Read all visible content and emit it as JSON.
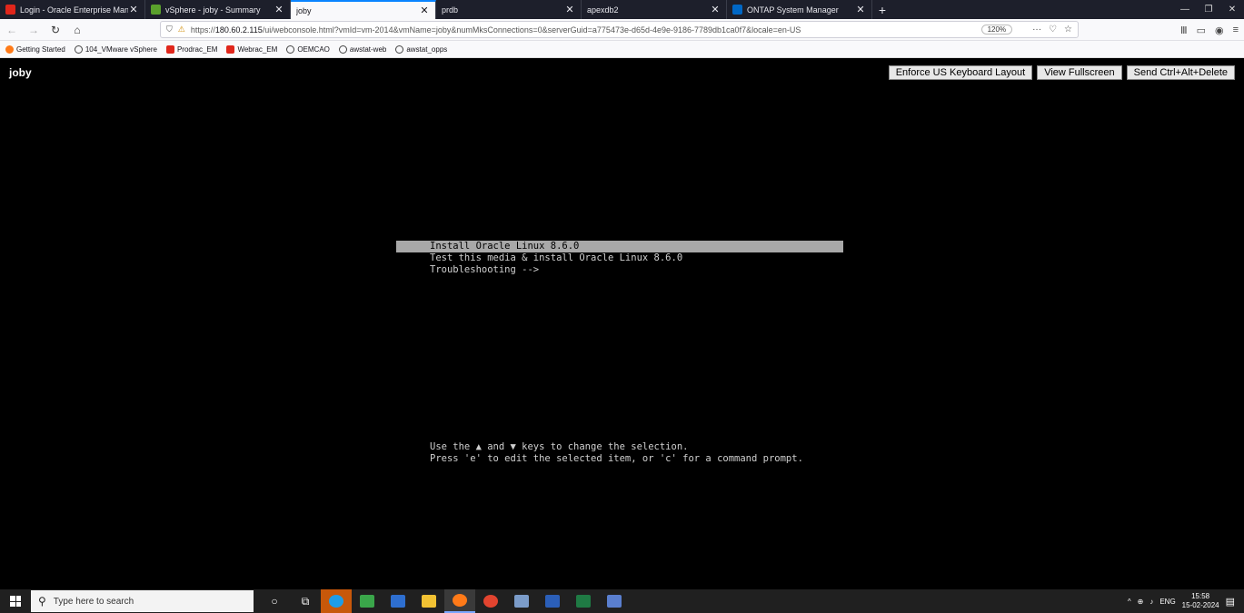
{
  "tabs": [
    {
      "label": "Login - Oracle Enterprise Mana",
      "favicon_color": "#e0261b",
      "active": false
    },
    {
      "label": "vSphere - joby - Summary",
      "favicon_color": "#5aa02c",
      "active": false
    },
    {
      "label": "joby",
      "favicon_color": "",
      "active": true
    },
    {
      "label": "prdb",
      "favicon_color": "",
      "active": false
    },
    {
      "label": "apexdb2",
      "favicon_color": "",
      "active": false
    },
    {
      "label": "ONTAP System Manager",
      "favicon_color": "#0067c5",
      "active": false
    }
  ],
  "tab_close_glyph": "✕",
  "new_tab_glyph": "+",
  "window_controls": [
    "—",
    "❐",
    "✕"
  ],
  "nav": {
    "back": "←",
    "forward": "→",
    "reload": "↻",
    "home": "⌂",
    "url_host": "180.60.2.115",
    "url_prefix": "https://",
    "url_rest": "/ui/webconsole.html?vmId=vm-2014&vmName=joby&numMksConnections=0&serverGuid=a775473e-d65d-4e9e-9186-7789db1ca0f7&locale=en-US",
    "zoom": "120%",
    "more": "···"
  },
  "bookmarks": [
    {
      "label": "Getting Started",
      "icon": "firefox-icon"
    },
    {
      "label": "104_VMware vSphere",
      "icon": "globe-icon"
    },
    {
      "label": "Prodrac_EM",
      "icon": "oracle-icon"
    },
    {
      "label": "Webrac_EM",
      "icon": "oracle-icon"
    },
    {
      "label": "OEMCAO",
      "icon": "globe-icon"
    },
    {
      "label": "awstat-web",
      "icon": "globe-icon"
    },
    {
      "label": "awstat_opps",
      "icon": "globe-icon"
    }
  ],
  "console": {
    "vm_name": "joby",
    "buttons": {
      "keyboard": "Enforce US Keyboard Layout",
      "fullscreen": "View Fullscreen",
      "cad": "Send Ctrl+Alt+Delete"
    },
    "grub_entries": [
      "Install Oracle Linux 8.6.0",
      "Test this media & install Oracle Linux 8.6.0",
      "Troubleshooting -->"
    ],
    "help_lines": [
      "Use the ▲ and ▼ keys to change the selection.",
      "Press 'e' to edit the selected item, or 'c' for a command prompt."
    ]
  },
  "taskbar": {
    "search_placeholder": "Type here to search",
    "time": "15:58",
    "date": "15-02-2024",
    "lang": "ENG"
  }
}
